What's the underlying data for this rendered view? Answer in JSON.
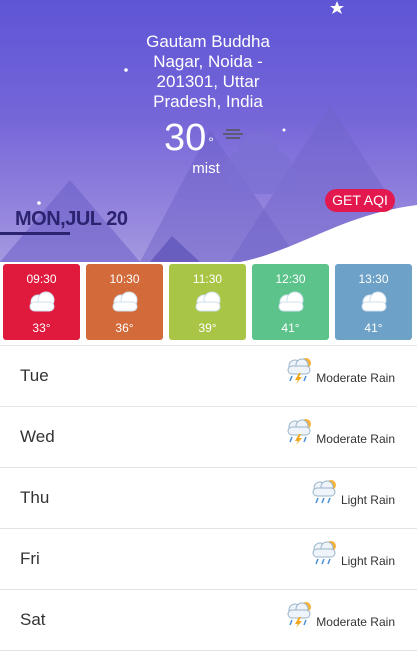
{
  "location": "Gautam Buddha Nagar, Noida - 201301, Uttar Pradesh, India",
  "current": {
    "temp": "30",
    "degree_symbol": "°",
    "condition": "mist",
    "icon": "haze-icon"
  },
  "aqi_button": "GET AQI",
  "date": {
    "day": "MON",
    "rest": ",JUL 20"
  },
  "hourly": [
    {
      "time": "09:30",
      "temp": "33°",
      "icon": "cloudy-icon",
      "color": "#e01a3c"
    },
    {
      "time": "10:30",
      "temp": "36°",
      "icon": "cloudy-icon",
      "color": "#d26a3a"
    },
    {
      "time": "11:30",
      "temp": "39°",
      "icon": "cloudy-icon",
      "color": "#a9c545"
    },
    {
      "time": "12:30",
      "temp": "41°",
      "icon": "cloudy-icon",
      "color": "#5cc48b"
    },
    {
      "time": "13:30",
      "temp": "41°",
      "icon": "cloudy-icon",
      "color": "#6ea1c8"
    }
  ],
  "daily": [
    {
      "day": "Tue",
      "condition": "Moderate Rain",
      "icon": "rain-thunder-icon"
    },
    {
      "day": "Wed",
      "condition": "Moderate Rain",
      "icon": "rain-thunder-icon"
    },
    {
      "day": "Thu",
      "condition": "Light Rain",
      "icon": "light-rain-icon"
    },
    {
      "day": "Fri",
      "condition": "Light Rain",
      "icon": "light-rain-icon"
    },
    {
      "day": "Sat",
      "condition": "Moderate Rain",
      "icon": "rain-thunder-icon"
    }
  ]
}
